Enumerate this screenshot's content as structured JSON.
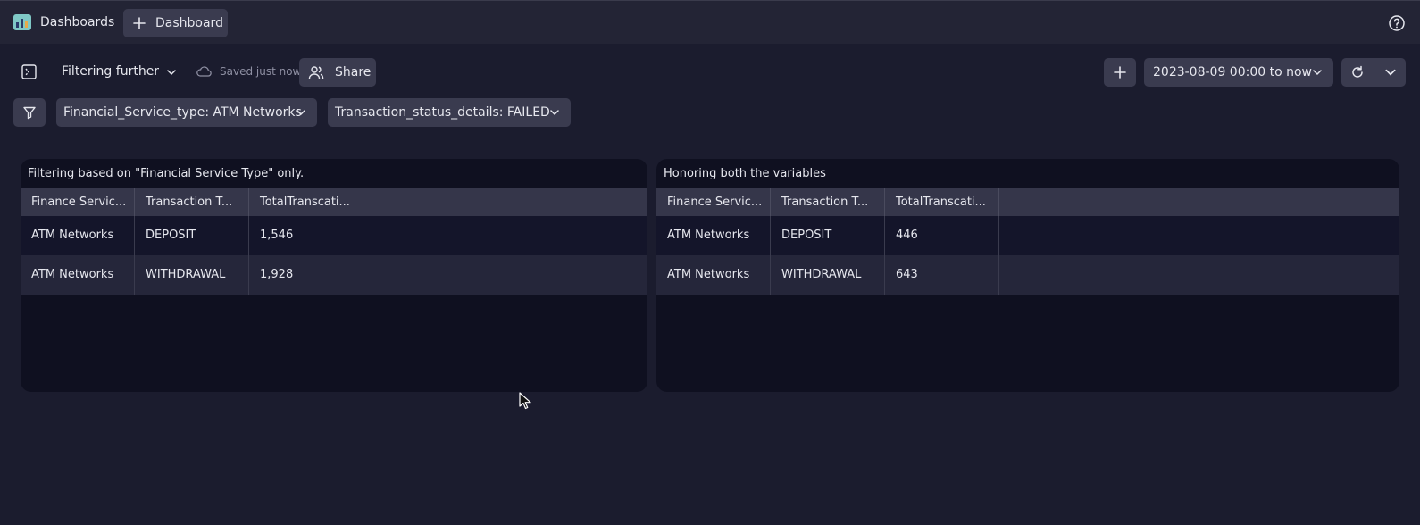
{
  "topbar": {
    "app_title": "Dashboards",
    "new_button_label": "Dashboard"
  },
  "toolbar": {
    "dashboard_name": "Filtering further",
    "save_status": "Saved just now",
    "share_label": "Share",
    "timeframe": "2023-08-09 00:00 to now"
  },
  "variables": [
    {
      "label": "Financial_Service_type: ATM Networks"
    },
    {
      "label": "Transaction_status_details: FAILED"
    }
  ],
  "tiles": [
    {
      "title": "Filtering based on \"Financial Service Type\" only.",
      "columns": [
        "Finance Servic...",
        "Transaction T...",
        "TotalTranscati..."
      ],
      "rows": [
        [
          "ATM Networks",
          "DEPOSIT",
          "1,546"
        ],
        [
          "ATM Networks",
          "WITHDRAWAL",
          "1,928"
        ]
      ]
    },
    {
      "title": "Honoring both the variables",
      "columns": [
        "Finance Servic...",
        "Transaction T...",
        "TotalTranscati..."
      ],
      "rows": [
        [
          "ATM Networks",
          "DEPOSIT",
          "446"
        ],
        [
          "ATM Networks",
          "WITHDRAWAL",
          "643"
        ]
      ]
    }
  ],
  "icons": {
    "app": "dashboards-app-icon",
    "help": "help-icon",
    "cursor": "mouse-pointer-icon"
  },
  "colors": {
    "background": "#1b1c2e",
    "topbar": "#232435",
    "button": "#3a3b4f",
    "tile": "#0f1020",
    "table_header": "#35364a"
  }
}
